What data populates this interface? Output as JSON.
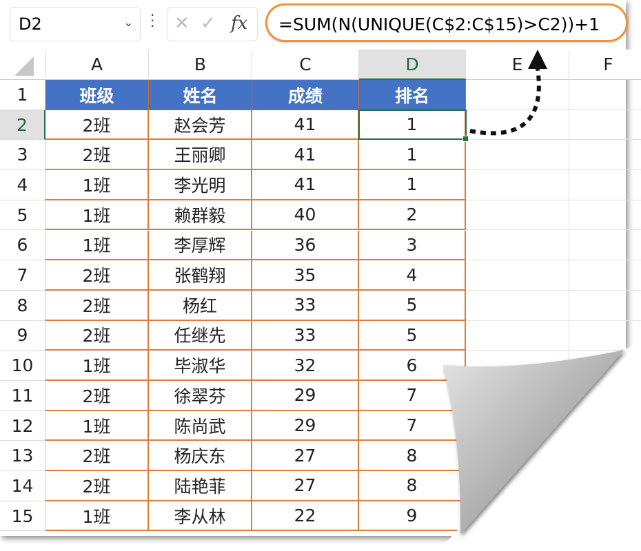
{
  "formula_bar": {
    "name_box": "D2",
    "cancel_icon": "✕",
    "enter_icon": "✓",
    "fx_label": "fx",
    "formula": "=SUM(N(UNIQUE(C$2:C$15)>C2))+1"
  },
  "columns": [
    "A",
    "B",
    "C",
    "D",
    "E",
    "F"
  ],
  "rows": [
    "1",
    "2",
    "3",
    "4",
    "5",
    "6",
    "7",
    "8",
    "9",
    "10",
    "11",
    "12",
    "13",
    "14",
    "15"
  ],
  "headers": [
    "班级",
    "姓名",
    "成绩",
    "排名"
  ],
  "data": [
    [
      "2班",
      "赵会芳",
      "41",
      "1"
    ],
    [
      "2班",
      "王丽卿",
      "41",
      "1"
    ],
    [
      "1班",
      "李光明",
      "41",
      "1"
    ],
    [
      "1班",
      "赖群毅",
      "40",
      "2"
    ],
    [
      "1班",
      "李厚辉",
      "36",
      "3"
    ],
    [
      "2班",
      "张鹤翔",
      "35",
      "4"
    ],
    [
      "2班",
      "杨红",
      "33",
      "5"
    ],
    [
      "2班",
      "任继先",
      "33",
      "5"
    ],
    [
      "1班",
      "毕淑华",
      "32",
      "6"
    ],
    [
      "2班",
      "徐翠芬",
      "29",
      "7"
    ],
    [
      "1班",
      "陈尚武",
      "29",
      "7"
    ],
    [
      "2班",
      "杨庆东",
      "27",
      "8"
    ],
    [
      "2班",
      "陆艳菲",
      "27",
      "8"
    ],
    [
      "1班",
      "李从林",
      "22",
      "9"
    ]
  ],
  "colors": {
    "header_fill": "#4472c4",
    "border": "#e07b39",
    "selection": "#217346",
    "highlight": "#f0923a"
  }
}
